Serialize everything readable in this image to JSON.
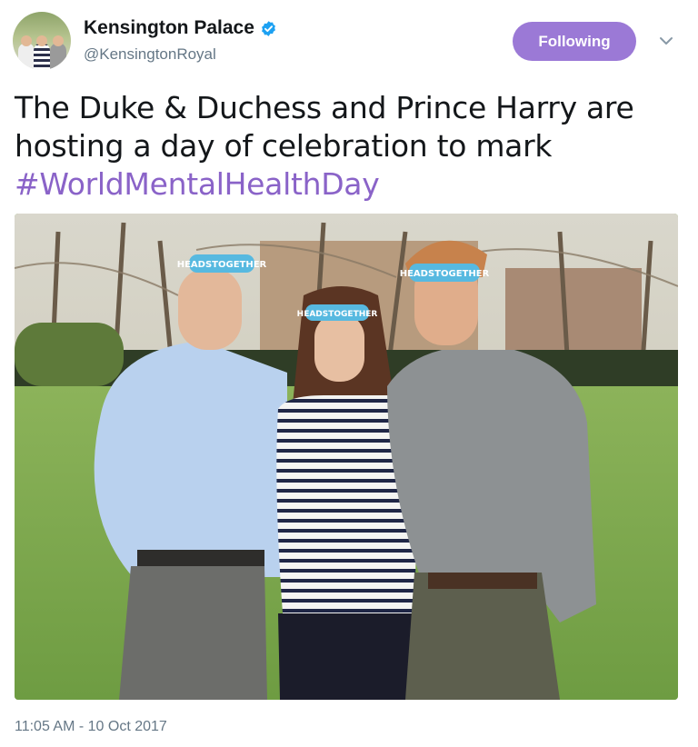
{
  "account": {
    "display_name": "Kensington Palace",
    "handle": "@KensingtonRoyal",
    "verified_icon": "verified-badge-icon"
  },
  "follow_button": {
    "label": "Following"
  },
  "menu": {
    "icon": "chevron-down-icon"
  },
  "tweet": {
    "line1": "The Duke & Duchess and Prince Harry are",
    "line2": "hosting a day of celebration to mark",
    "hashtag": "#WorldMentalHealthDay"
  },
  "media": {
    "description_icon": "photo-image",
    "headband_text": "HEADSTOGETHER"
  },
  "timestamp": "11:05 AM - 10 Oct 2017",
  "colors": {
    "brand_purple": "#9b79d6",
    "hashtag_purple": "#8a63c8",
    "verified_blue": "#1da1f2",
    "secondary_text": "#657786"
  }
}
